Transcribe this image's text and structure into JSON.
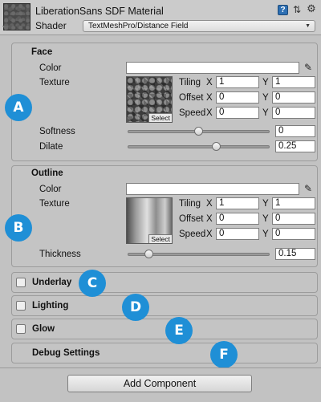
{
  "header": {
    "material_title": "LiberationSans SDF Material",
    "shader_label": "Shader",
    "shader_value": "TextMeshPro/Distance Field",
    "help_icon_glyph": "?",
    "preset_icon_glyph": "⇅",
    "gear_icon_glyph": "⚙"
  },
  "face": {
    "title": "Face",
    "color_label": "Color",
    "color_value": "#ffffff",
    "texture_label": "Texture",
    "select_label": "Select",
    "tiling_label": "Tiling",
    "offset_label": "Offset",
    "speed_label": "Speed",
    "x_label": "X",
    "y_label": "Y",
    "tiling_x": "1",
    "tiling_y": "1",
    "offset_x": "0",
    "offset_y": "0",
    "speed_x": "0",
    "speed_y": "0",
    "softness_label": "Softness",
    "softness_value": "0",
    "softness_fraction": 0.5,
    "dilate_label": "Dilate",
    "dilate_value": "0.25",
    "dilate_fraction": 0.625
  },
  "outline": {
    "title": "Outline",
    "color_label": "Color",
    "color_value": "#ffffff",
    "texture_label": "Texture",
    "select_label": "Select",
    "tiling_label": "Tiling",
    "offset_label": "Offset",
    "speed_label": "Speed",
    "x_label": "X",
    "y_label": "Y",
    "tiling_x": "1",
    "tiling_y": "1",
    "offset_x": "0",
    "offset_y": "0",
    "speed_x": "0",
    "speed_y": "0",
    "thickness_label": "Thickness",
    "thickness_value": "0.15",
    "thickness_fraction": 0.15
  },
  "foldouts": {
    "underlay": "Underlay",
    "lighting": "Lighting",
    "glow": "Glow",
    "debug": "Debug Settings"
  },
  "badges": {
    "a": "A",
    "b": "B",
    "c": "C",
    "d": "D",
    "e": "E",
    "f": "F"
  },
  "footer": {
    "add_component": "Add Component"
  },
  "colors": {
    "badge": "#1f8fd6",
    "panel": "#c4c4c4",
    "background": "#c2c2c2"
  }
}
